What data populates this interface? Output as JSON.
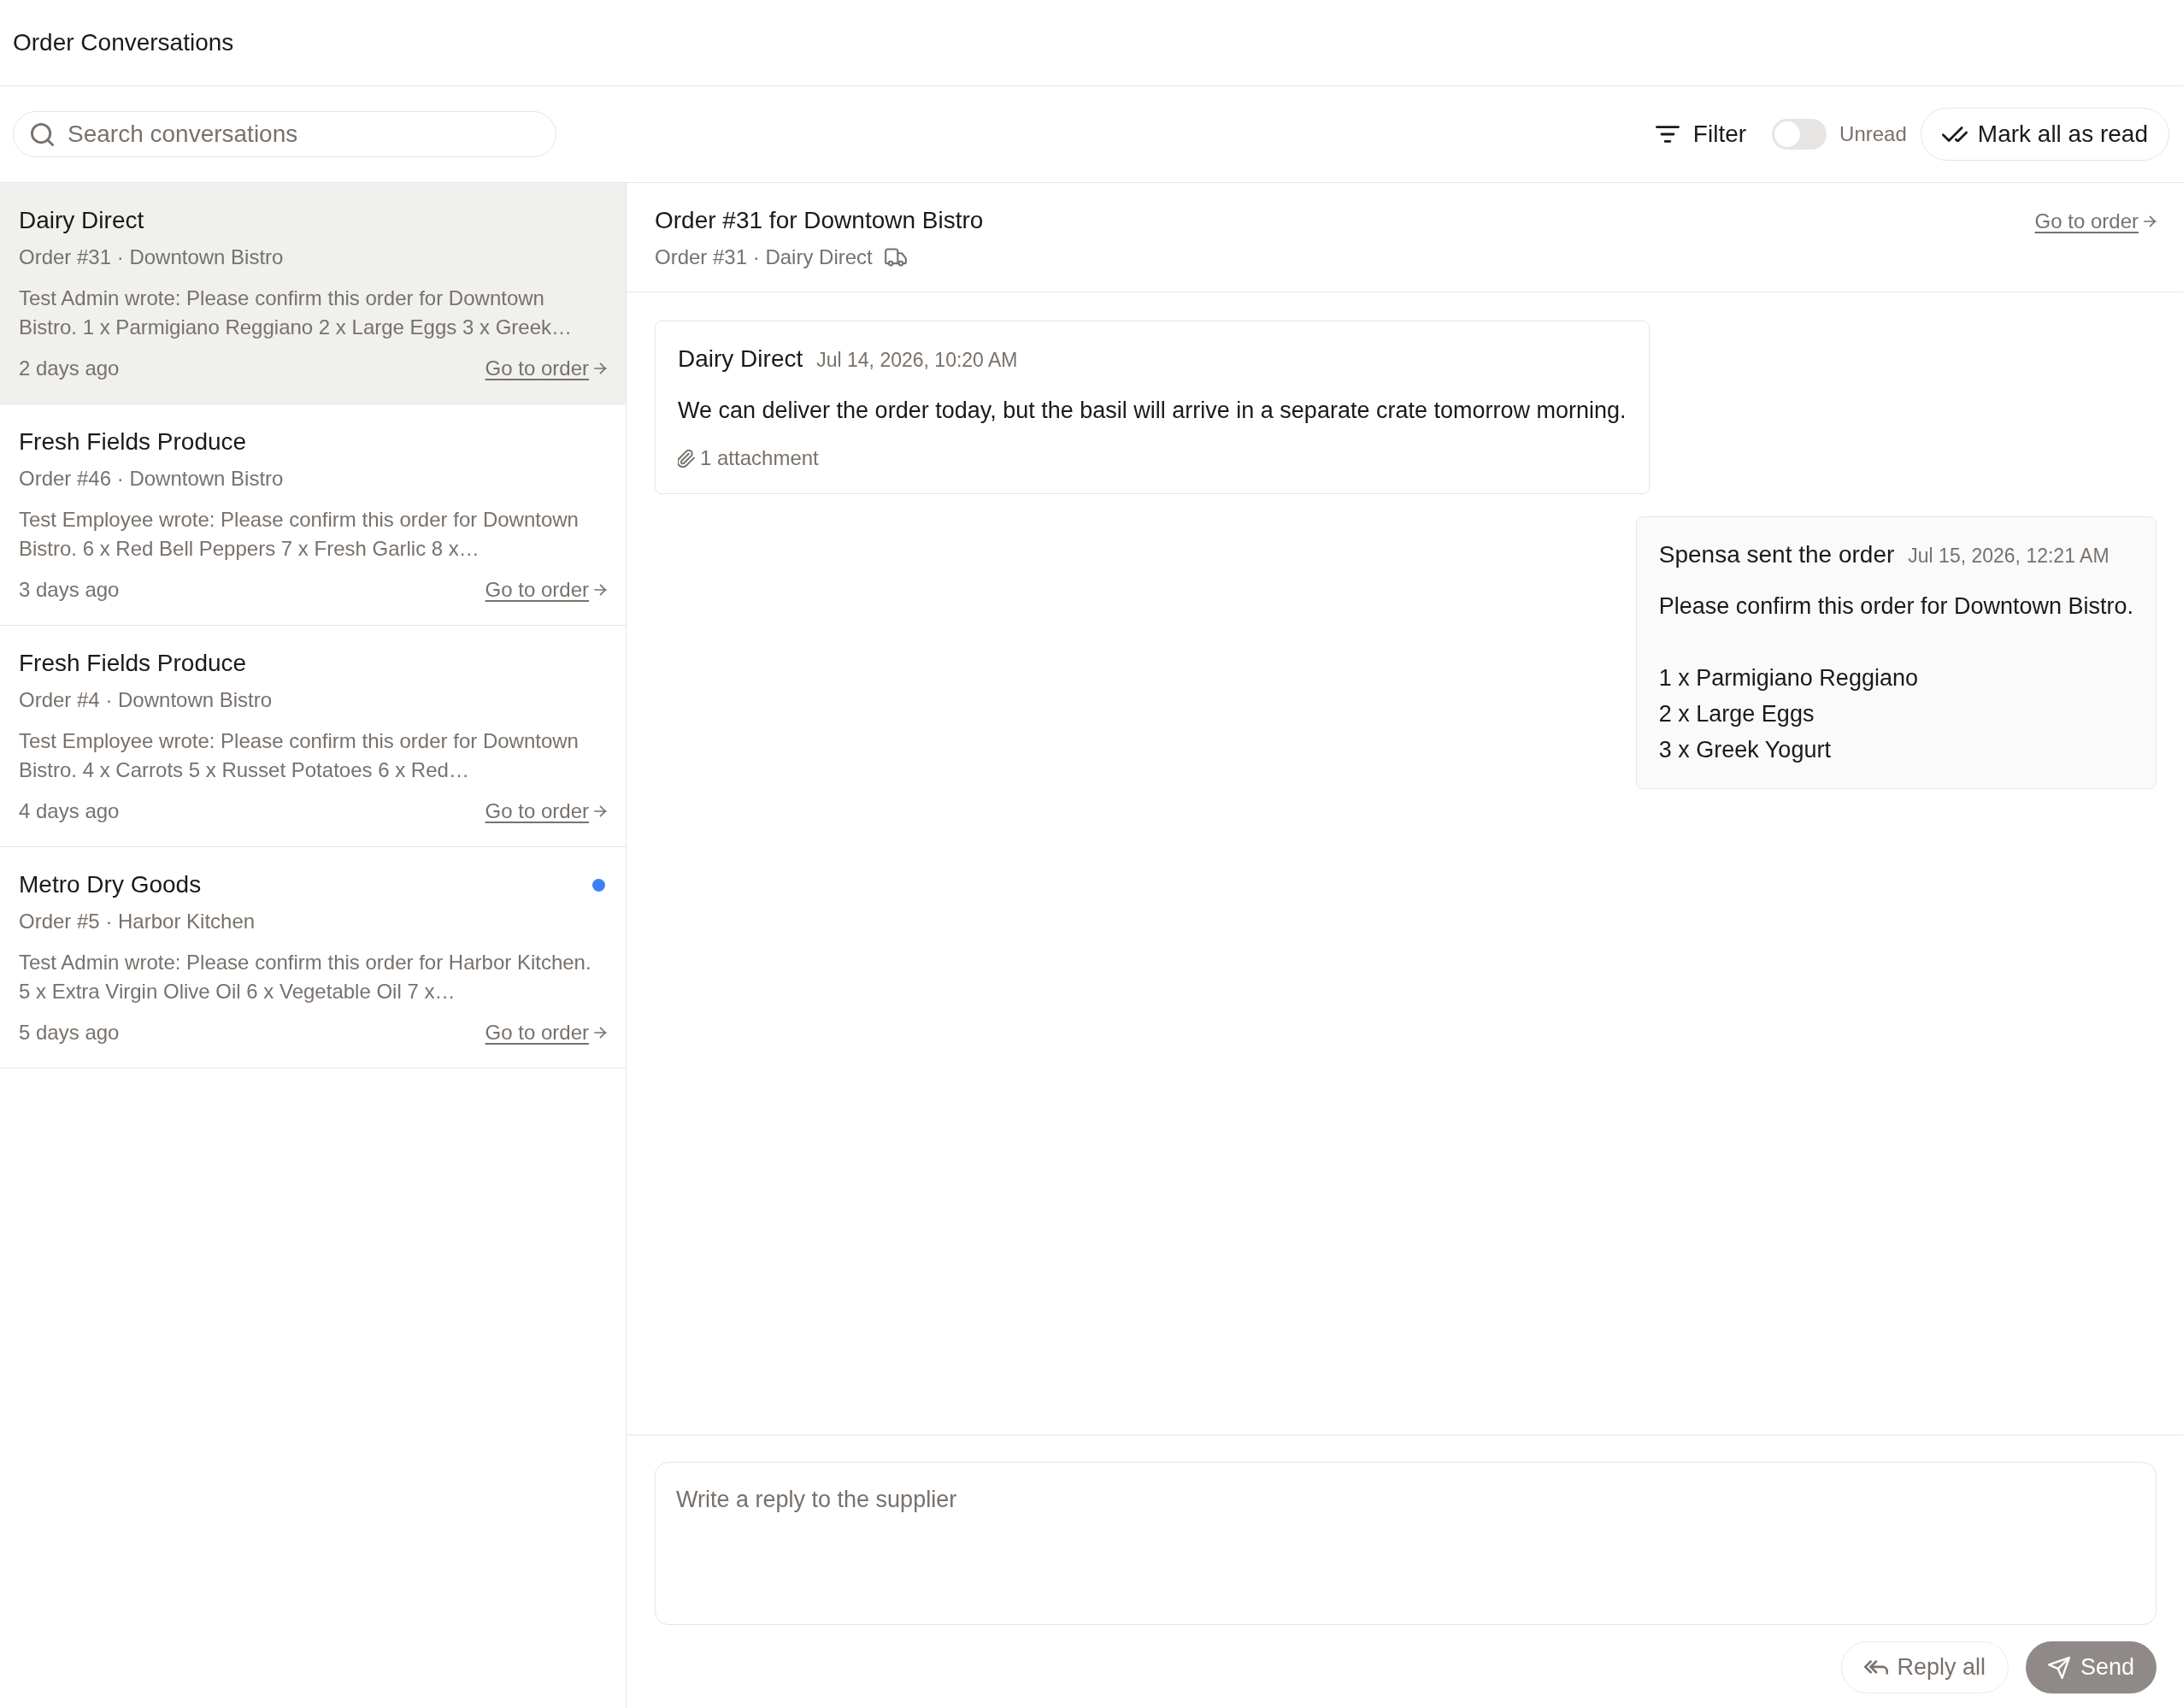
{
  "header": {
    "title": "Order Conversations"
  },
  "toolbar": {
    "search": {
      "placeholder": "Search conversations"
    },
    "filter": {
      "label": "Filter"
    },
    "unread_toggle": {
      "label": "Unread",
      "on": false
    },
    "mark_all_read": {
      "label": "Mark all as read"
    }
  },
  "conversations": [
    {
      "supplier": "Dairy Direct",
      "order": "Order #31 · Downtown Bistro",
      "preview": "Test Admin wrote: Please confirm this order for Downtown Bistro. 1 x Parmigiano Reggiano 2 x Large Eggs 3 x Greek…",
      "time": "2 days ago",
      "link": "Go to order",
      "selected": true,
      "unread": false
    },
    {
      "supplier": "Fresh Fields Produce",
      "order": "Order #46 · Downtown Bistro",
      "preview": "Test Employee wrote: Please confirm this order for Downtown Bistro. 6 x Red Bell Peppers 7 x Fresh Garlic 8 x…",
      "time": "3 days ago",
      "link": "Go to order",
      "selected": false,
      "unread": false
    },
    {
      "supplier": "Fresh Fields Produce",
      "order": "Order #4 · Downtown Bistro",
      "preview": "Test Employee wrote: Please confirm this order for Downtown Bistro. 4 x Carrots 5 x Russet Potatoes 6 x Red…",
      "time": "4 days ago",
      "link": "Go to order",
      "selected": false,
      "unread": false
    },
    {
      "supplier": "Metro Dry Goods",
      "order": "Order #5 · Harbor Kitchen",
      "preview": "Test Admin wrote: Please confirm this order for Harbor Kitchen. 5 x Extra Virgin Olive Oil 6 x Vegetable Oil 7 x…",
      "time": "5 days ago",
      "link": "Go to order",
      "selected": false,
      "unread": true
    }
  ],
  "thread": {
    "title": "Order #31 for Downtown Bistro",
    "meta": "Order #31 · Dairy Direct",
    "link": "Go to order",
    "messages": [
      {
        "kind": "received",
        "sender": "Dairy Direct",
        "time": "Jul 14, 2026, 10:20 AM",
        "body": [
          "We can deliver the order today, but the basil will arrive in a separate crate tomorrow morning."
        ],
        "attachment": "1 attachment"
      },
      {
        "kind": "sent",
        "sender": "Spensa sent the order",
        "time": "Jul 15, 2026, 12:21 AM",
        "body": [
          "Please confirm this order for Downtown Bistro."
        ],
        "items": [
          "1 x Parmigiano Reggiano",
          "2 x Large Eggs",
          "3 x Greek Yogurt"
        ]
      }
    ]
  },
  "composer": {
    "placeholder": "Write a reply to the supplier",
    "reply_all": {
      "label": "Reply all",
      "disabled": true
    },
    "send": {
      "label": "Send",
      "disabled": true
    }
  }
}
